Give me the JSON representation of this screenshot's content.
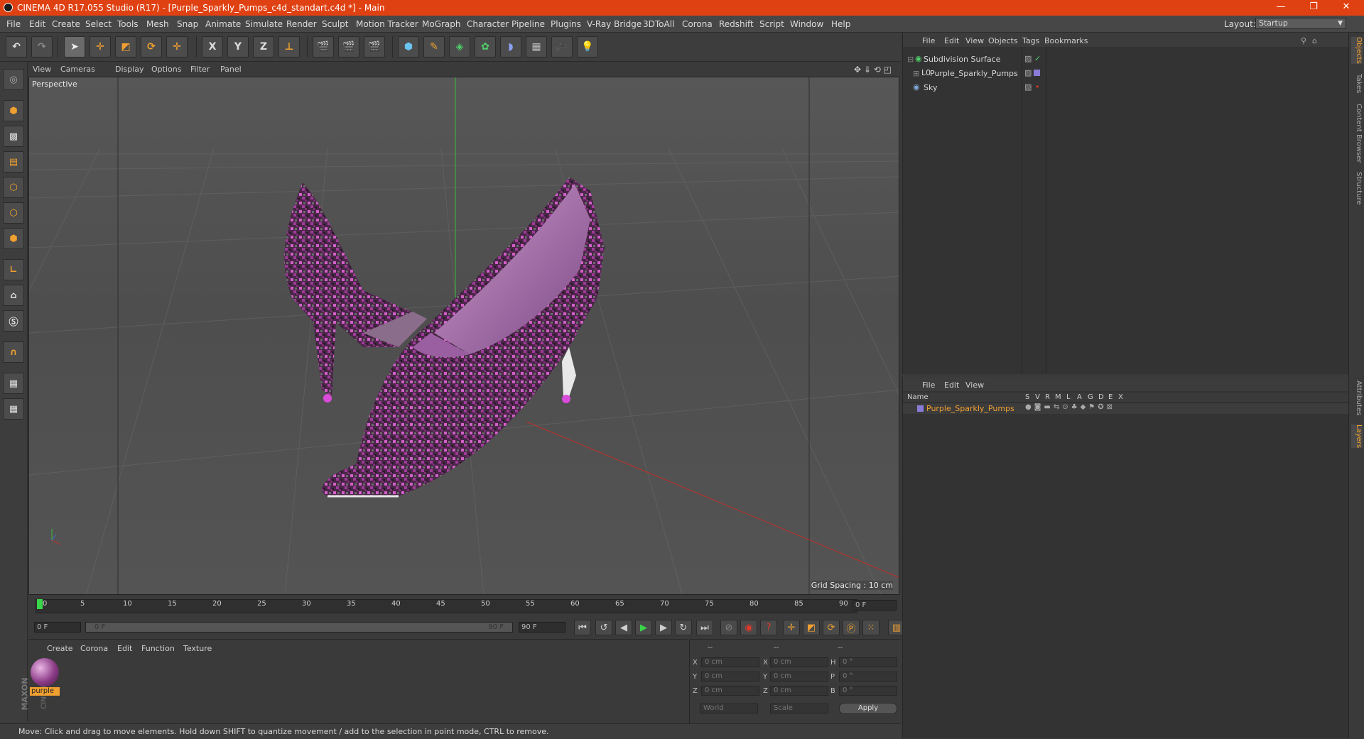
{
  "window": {
    "title": "CINEMA 4D R17.055 Studio (R17) - [Purple_Sparkly_Pumps_c4d_standart.c4d *] - Main",
    "minimize": "—",
    "restore": "❐",
    "close": "✕"
  },
  "menubar": {
    "items": [
      "File",
      "Edit",
      "Create",
      "Select",
      "Tools",
      "Mesh",
      "Snap",
      "Animate",
      "Simulate",
      "Render",
      "Sculpt",
      "Motion Tracker",
      "MoGraph",
      "Character",
      "Pipeline",
      "Plugins",
      "V-Ray Bridge",
      "3DToAll",
      "Corona",
      "Redshift",
      "Script",
      "Window",
      "Help"
    ],
    "layout_label": "Layout:",
    "layout_value": "Startup"
  },
  "toolbar": {
    "axis_x": "X",
    "axis_y": "Y",
    "axis_z": "Z"
  },
  "viewport": {
    "menu": [
      "View",
      "Cameras",
      "Display",
      "Options",
      "Filter",
      "Panel"
    ],
    "label": "Perspective",
    "grid_spacing": "Grid Spacing : 10 cm"
  },
  "timeline": {
    "ticks": [
      "0",
      "5",
      "10",
      "15",
      "20",
      "25",
      "30",
      "35",
      "40",
      "45",
      "50",
      "55",
      "60",
      "65",
      "70",
      "75",
      "80",
      "85",
      "90"
    ],
    "current_frame": "0 F",
    "start_field": "0 F",
    "range_start": "0 F",
    "range_end": "90 F",
    "end_field": "90 F"
  },
  "material_manager": {
    "menu": [
      "Create",
      "Corona",
      "Edit",
      "Function",
      "Texture"
    ],
    "material_name": "purple",
    "brand_1": "MAXON",
    "brand_2": "CINEMA 4D"
  },
  "coordinates": {
    "headers": [
      "--",
      "--",
      "--"
    ],
    "rows": [
      {
        "a": "X",
        "av": "0 cm",
        "b": "X",
        "bv": "0 cm",
        "c": "H",
        "cv": "0 °"
      },
      {
        "a": "Y",
        "av": "0 cm",
        "b": "Y",
        "bv": "0 cm",
        "c": "P",
        "cv": "0 °"
      },
      {
        "a": "Z",
        "av": "0 cm",
        "b": "Z",
        "bv": "0 cm",
        "c": "B",
        "cv": "0 °"
      }
    ],
    "world": "World",
    "scale": "Scale",
    "apply": "Apply"
  },
  "status": "Move: Click and drag to move elements. Hold down SHIFT to quantize movement / add to the selection in point mode, CTRL to remove.",
  "object_manager": {
    "menu": [
      "File",
      "Edit",
      "View",
      "Objects",
      "Tags",
      "Bookmarks"
    ],
    "objects": [
      "Subdivision Surface",
      "Purple_Sparkly_Pumps",
      "Sky"
    ]
  },
  "layer_manager": {
    "menu": [
      "File",
      "Edit",
      "View"
    ],
    "columns": [
      "Name",
      "S",
      "V",
      "R",
      "M",
      "L",
      "A",
      "G",
      "D",
      "E",
      "X"
    ],
    "layer_name": "Purple_Sparkly_Pumps"
  },
  "side_tabs": [
    "Objects",
    "Takes",
    "Content Browser",
    "Structure",
    "Attributes",
    "Layers"
  ],
  "colors": {
    "title_bar": "#e04112",
    "accent_orange": "#f0a030",
    "layer_purple": "#8b7bd8"
  }
}
